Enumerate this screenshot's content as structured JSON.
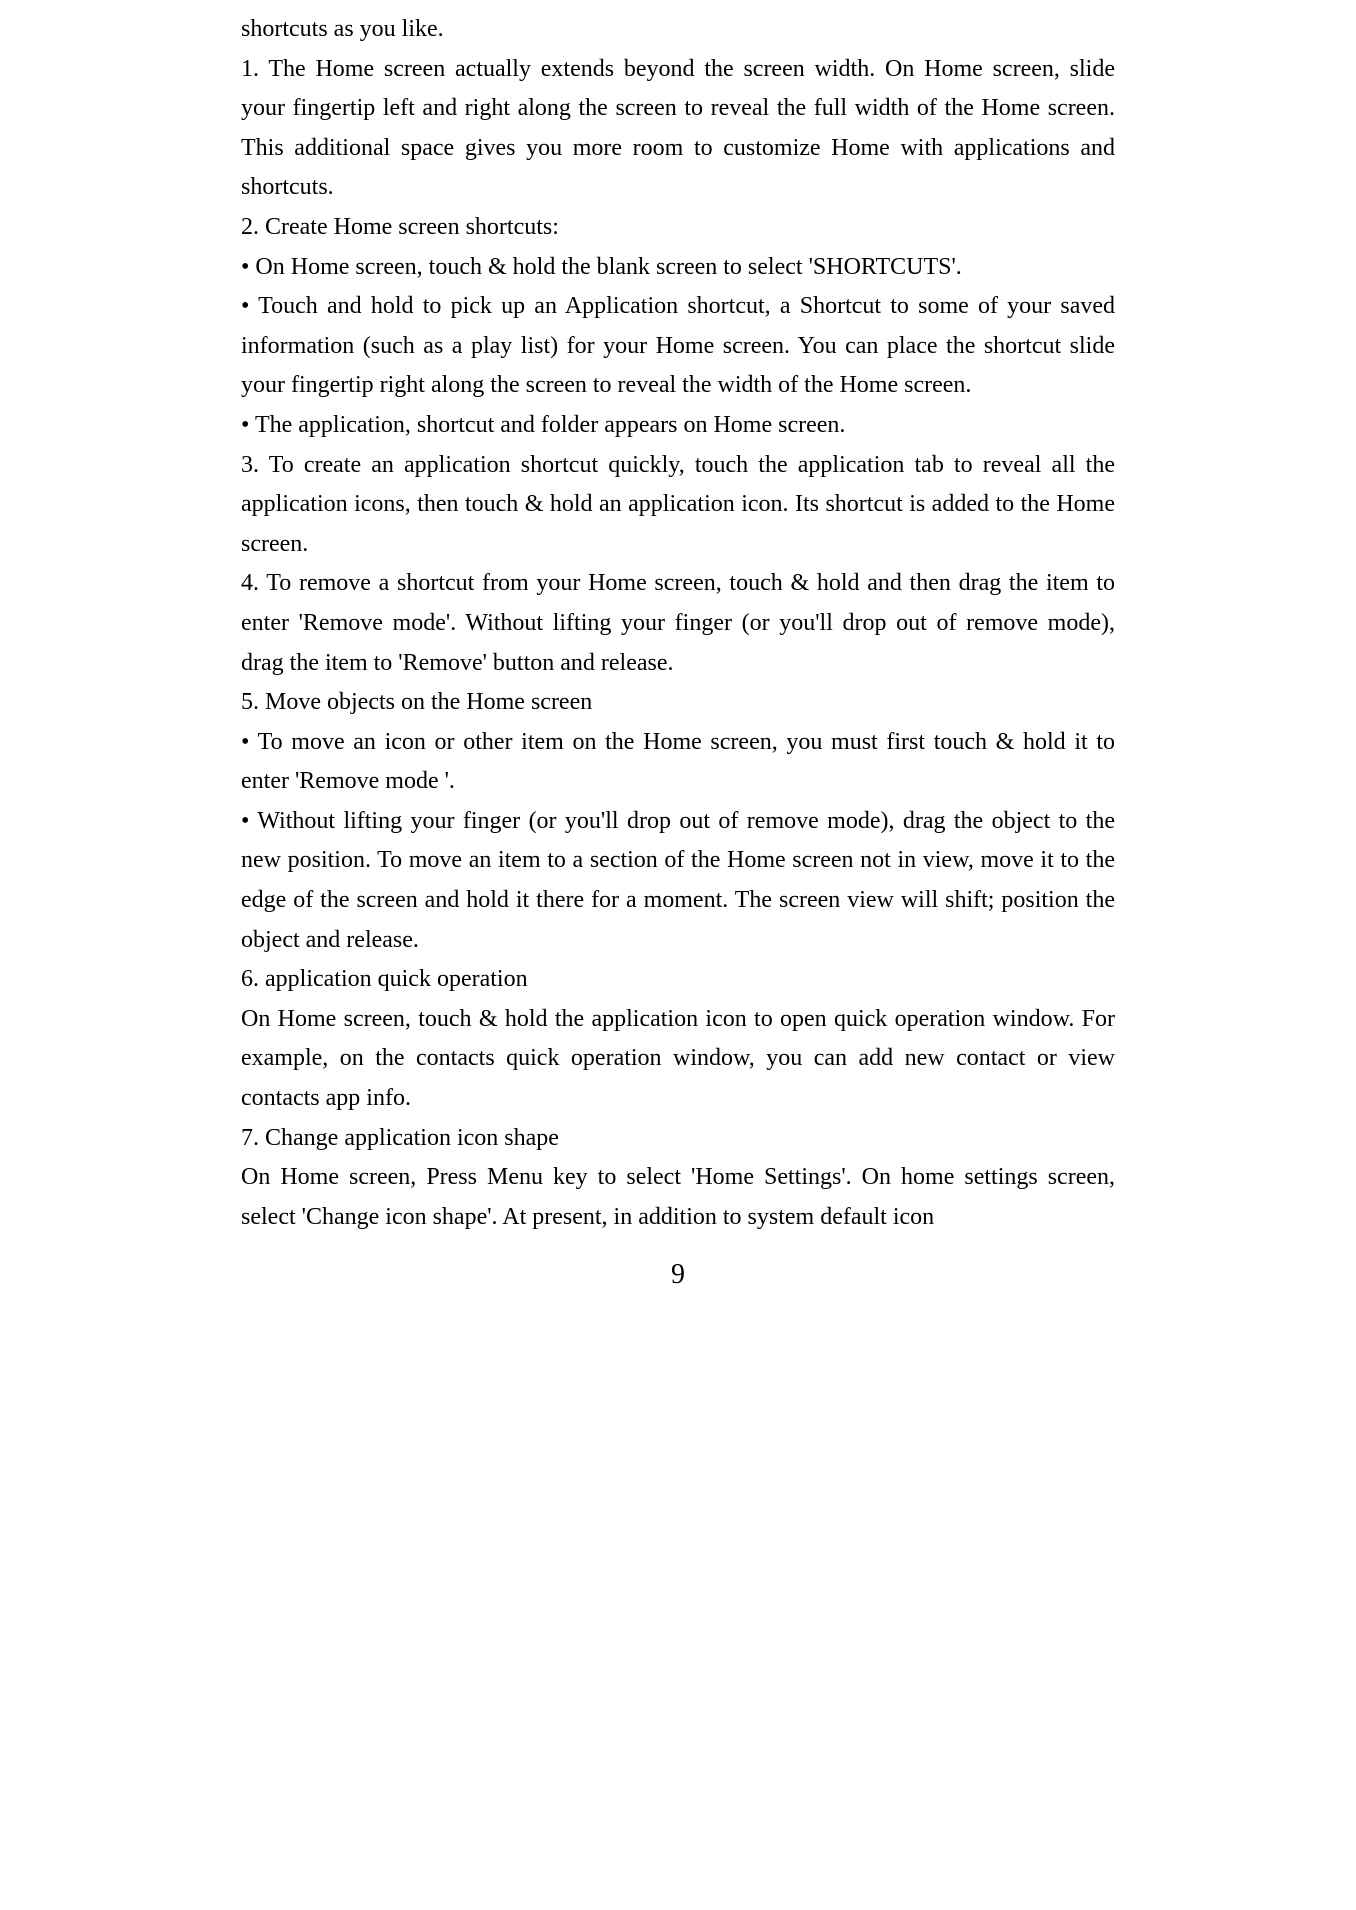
{
  "document": {
    "p0": "shortcuts as you like.",
    "p1": "1. The Home screen actually extends beyond the screen width. On Home screen, slide your fingertip left and right along the screen to reveal the full width of the Home screen. This additional space gives you more room to customize Home with applications and shortcuts.",
    "p2": "2. Create Home screen shortcuts:",
    "p3": "• On Home screen, touch & hold the blank screen to select 'SHORTCUTS'.",
    "p4": "• Touch and hold to pick up an Application shortcut, a Shortcut to some of your saved information (such as a play list) for your Home screen. You can place the shortcut slide your fingertip right along the screen to reveal the width of the Home screen.",
    "p5": "• The application, shortcut and folder appears on Home screen.",
    "p6": "3. To create an application shortcut quickly, touch the application tab to reveal all the application icons, then touch & hold an application icon. Its shortcut is added to the Home screen.",
    "p7": "4. To remove a shortcut from your Home screen, touch & hold and then drag the item to enter 'Remove mode'. Without lifting your finger (or you'll drop out of remove mode), drag the item to 'Remove' button and release.",
    "p8": "5. Move objects on the Home screen",
    "p9": "• To move an icon or other item on the Home screen, you must first touch & hold it to enter 'Remove mode '.",
    "p10": "• Without lifting your finger (or you'll drop out of remove mode), drag the object to the new position. To move an item to a section of the Home screen not in view, move it to the edge of the screen and hold it there for a moment. The screen view will shift; position the object and release.",
    "p11": "6. application quick operation",
    "p12": "On Home screen, touch & hold the application icon to open quick operation window. For example, on the contacts quick operation window, you can add new contact or view contacts app info.",
    "p13": "7. Change application icon shape",
    "p14": "On Home screen, Press Menu key to select 'Home Settings'. On home settings screen, select 'Change icon shape'. At present, in addition to system default icon",
    "pageNumber": "9"
  }
}
